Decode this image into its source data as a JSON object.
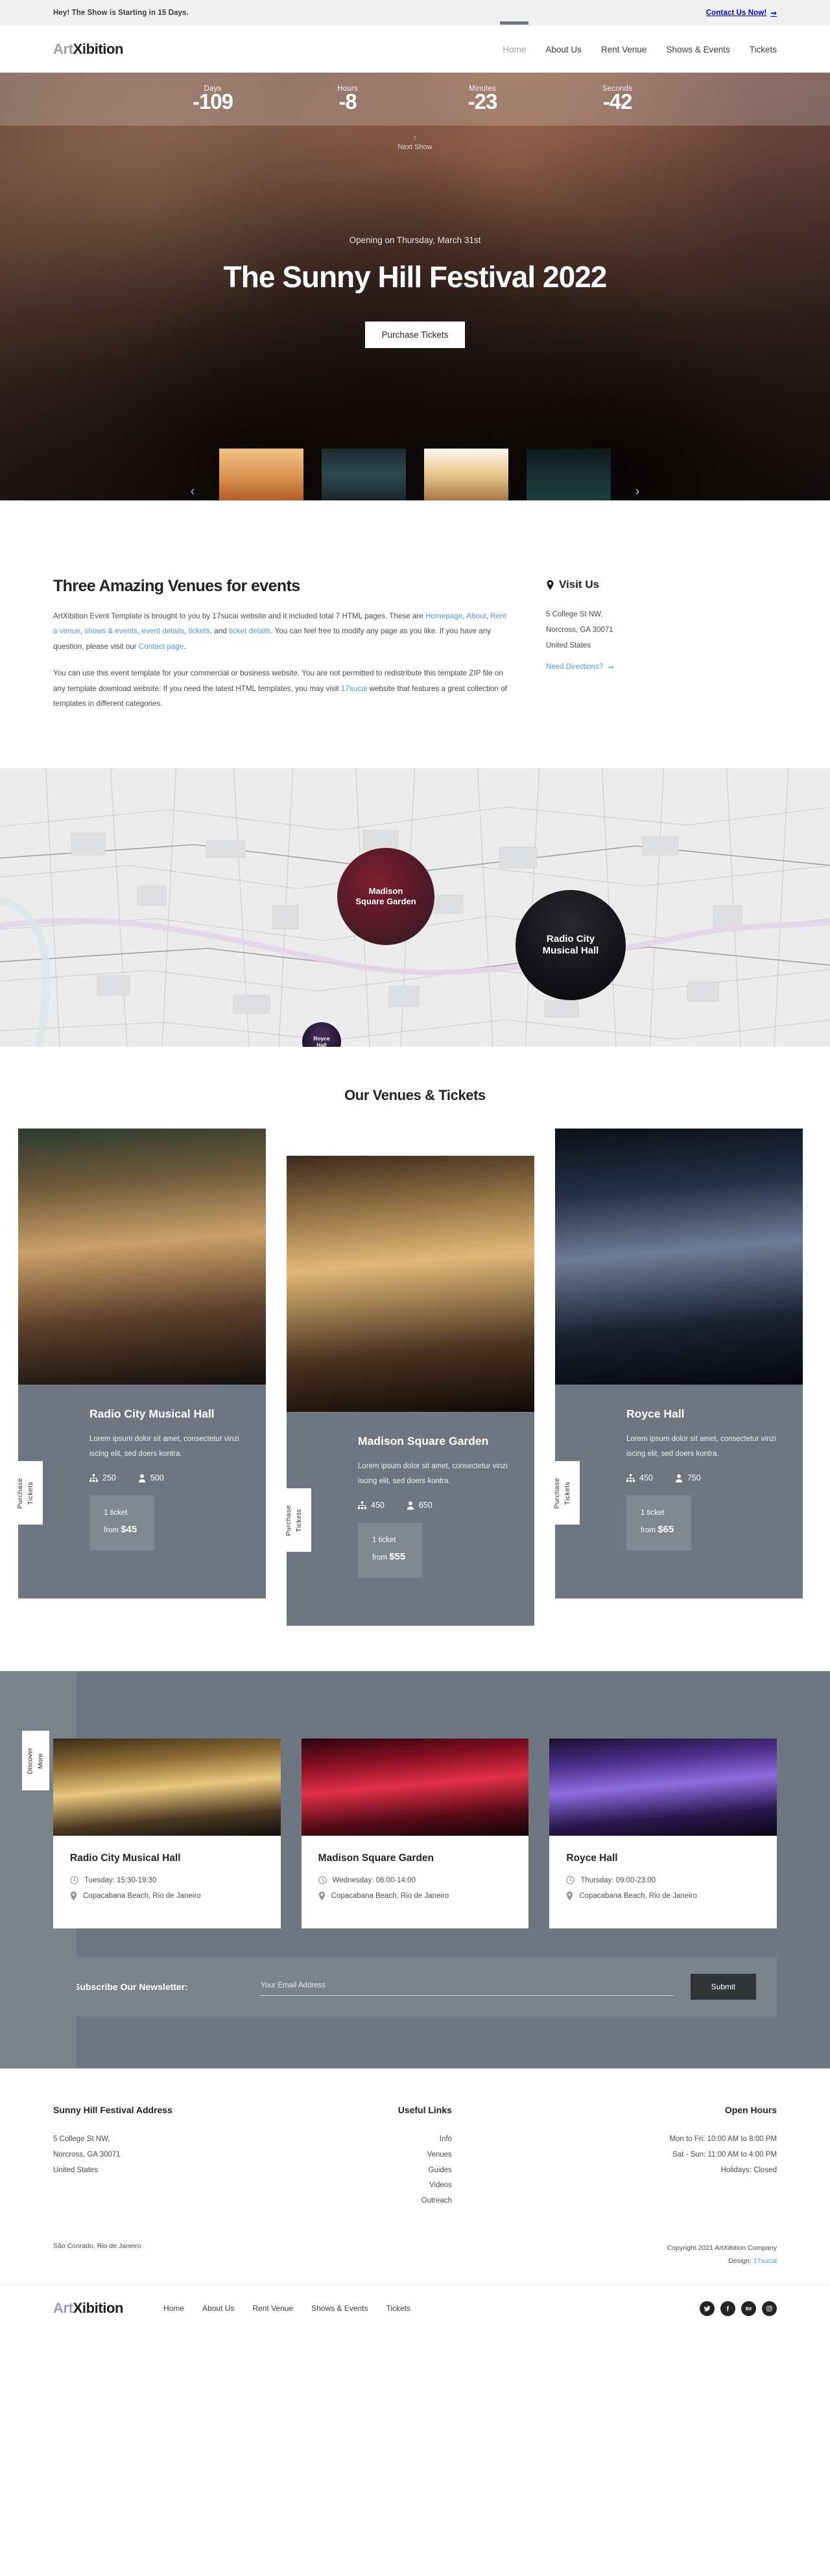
{
  "topbar": {
    "message": "Hey! The Show is Starting in 15 Days.",
    "cta": "Contact Us Now!",
    "cta_icon": "arrow-right-icon"
  },
  "header": {
    "logo_part1": "Art",
    "logo_part2": "Xibition",
    "nav": [
      {
        "label": "Home",
        "active": true
      },
      {
        "label": "About Us",
        "active": false
      },
      {
        "label": "Rent Venue",
        "active": false
      },
      {
        "label": "Shows & Events",
        "active": false
      },
      {
        "label": "Tickets",
        "active": false
      }
    ]
  },
  "hero": {
    "countdown": [
      {
        "label": "Days",
        "value": "-109"
      },
      {
        "label": "Hours",
        "value": "-8"
      },
      {
        "label": "Minutes",
        "value": "-23"
      },
      {
        "label": "Seconds",
        "value": "-42"
      }
    ],
    "next_show_arrow": "↑",
    "next_show_label": "Next Show",
    "kicker": "Opening on Thursday, March 31st",
    "title": "The Sunny Hill Festival 2022",
    "cta": "Purchase Tickets",
    "prev_arrow": "‹",
    "next_arrow": "›"
  },
  "intro": {
    "heading": "Three Amazing Venues for events",
    "p1_a": "ArtXibition Event Template is brought to you by 17sucai website and it included total 7 HTML pages. These are ",
    "p1_links": [
      "Homepage",
      "About",
      "Rent a venue",
      "shows & events",
      "event details",
      "tickets"
    ],
    "p1_b": ", and ",
    "p1_link_last": "ticket details",
    "p1_c": ". You can feel free to modify any page as you like. If you have any question, please visit our ",
    "p1_link_contact": "Contact page",
    "p1_d": ".",
    "p2_a": "You can use this event template for your commercial or business website. You are not permitted to redistribute this template ZIP file on any template download website. If you need the latest HTML templates, you may visit ",
    "p2_link": "17sucai",
    "p2_b": " website that features a great collection of templates in different categories.",
    "visit_title": "Visit Us",
    "visit_icon": "map-pin-icon",
    "address": [
      "5 College St NW,",
      "Norcross, GA 30071",
      "United States"
    ],
    "directions": "Need Directions?",
    "directions_icon": "arrow-right-icon"
  },
  "map": {
    "venues": [
      {
        "name": "Madison\nSquare Garden",
        "line1": "Madison",
        "line2": "Square Garden"
      },
      {
        "name": "Radio City Musical Hall",
        "line1": "Radio City",
        "line2": "Musical Hall"
      },
      {
        "name": "Royce Hall",
        "line1": "Royce",
        "line2": "Hall"
      }
    ]
  },
  "venues": {
    "title": "Our Venues & Tickets",
    "purchase_label_line1": "Purchase",
    "purchase_label_line2": "Tickets",
    "cards": [
      {
        "name": "Radio City Musical Hall",
        "desc": "Lorem ipsum dolor sit amet, consectetur vinzi iscing elit, sed doers kontra.",
        "stat_seats_icon": "sitemap-icon",
        "stat_seats": "250",
        "stat_people_icon": "user-icon",
        "stat_people": "500",
        "ticket_label": "1 ticket",
        "price_prefix": "from",
        "price": "$45"
      },
      {
        "name": "Madison Square Garden",
        "desc": "Lorem ipsum dolor sit amet, consectetur vinzi iscing elit, sed doers kontra.",
        "stat_seats_icon": "sitemap-icon",
        "stat_seats": "450",
        "stat_people_icon": "user-icon",
        "stat_people": "650",
        "ticket_label": "1 ticket",
        "price_prefix": "from",
        "price": "$55"
      },
      {
        "name": "Royce Hall",
        "desc": "Lorem ipsum dolor sit amet, consectetur vinzi iscing elit, sed doers kontra.",
        "stat_seats_icon": "sitemap-icon",
        "stat_seats": "450",
        "stat_people_icon": "user-icon",
        "stat_people": "750",
        "ticket_label": "1 ticket",
        "price_prefix": "from",
        "price": "$65"
      }
    ]
  },
  "events": {
    "discover_line1": "Discover",
    "discover_line2": "More",
    "cards": [
      {
        "name": "Radio City Musical Hall",
        "time_icon": "clock-icon",
        "time": "Tuesday: 15:30-19:30",
        "place_icon": "map-pin-icon",
        "place": "Copacabana Beach, Rio de Janeiro"
      },
      {
        "name": "Madison Square Garden",
        "time_icon": "clock-icon",
        "time": "Wednesday: 08:00-14:00",
        "place_icon": "map-pin-icon",
        "place": "Copacabana Beach, Rio de Janeiro"
      },
      {
        "name": "Royce Hall",
        "time_icon": "clock-icon",
        "time": "Thursday: 09:00-23:00",
        "place_icon": "map-pin-icon",
        "place": "Copacabana Beach, Rio de Janeiro"
      }
    ]
  },
  "newsletter": {
    "label": "Subscribe Our Newsletter:",
    "placeholder": "Your Email Address",
    "value": "",
    "submit": "Submit"
  },
  "footer": {
    "address_title": "Sunny Hill Festival Address",
    "address_lines": [
      "5 College St NW,",
      "Norcross, GA 30071",
      "United States"
    ],
    "links_title": "Useful Links",
    "links": [
      "Info",
      "Venues",
      "Guides",
      "Videos",
      "Outreach"
    ],
    "hours_title": "Open Hours",
    "hours": [
      "Mon to Fri: 10:00 AM to 8:00 PM",
      "Sat - Sun: 11:00 AM to 4:00 PM",
      "Holidays: Closed"
    ],
    "legal_left": "São Conrado, Rio de Janeiro",
    "legal_right_1": "Copyright 2021 ArtXibition Company",
    "legal_right_2_prefix": "Design: ",
    "legal_right_2_link": "17sucai",
    "logo_part1": "Art",
    "logo_part2": "Xibition",
    "nav": [
      "Home",
      "About Us",
      "Rent Venue",
      "Shows & Events",
      "Tickets"
    ],
    "socials": [
      {
        "name": "twitter-icon",
        "glyph": "ᴠ"
      },
      {
        "name": "facebook-icon",
        "glyph": "f"
      },
      {
        "name": "behance-icon",
        "glyph": "Bē"
      },
      {
        "name": "instagram-icon",
        "glyph": "▣"
      }
    ]
  },
  "colors": {
    "accent_link": "#4d96e0",
    "slate": "#6e7781",
    "dark": "#232323"
  }
}
